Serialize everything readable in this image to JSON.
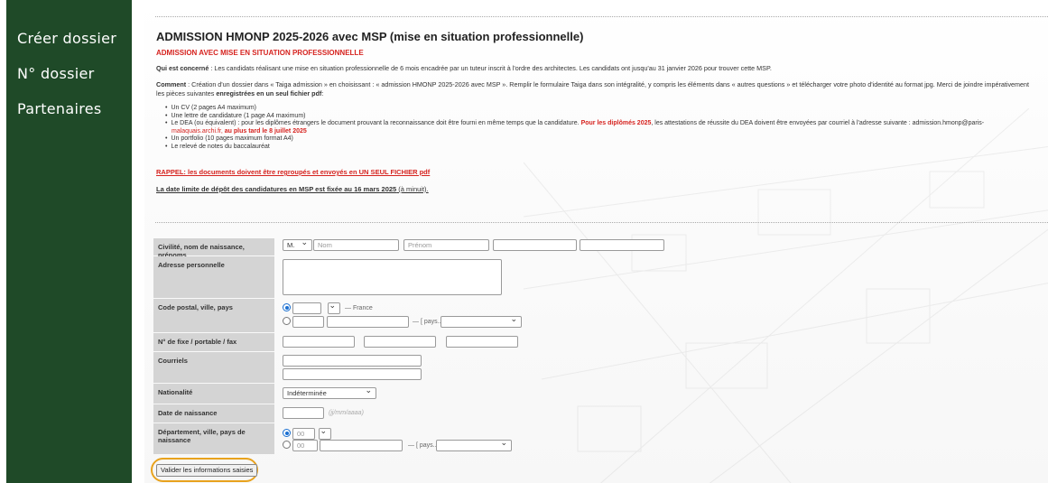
{
  "sidebar": {
    "items": [
      {
        "label": "Créer dossier"
      },
      {
        "label": "N° dossier"
      },
      {
        "label": "Partenaires"
      }
    ]
  },
  "page": {
    "title": "ADMISSION HMONP 2025-2026 avec MSP (mise en situation professionnelle)",
    "red_subtitle": "ADMISSION AVEC MISE EN SITUATION PROFESSIONNELLE",
    "who_label": "Qui est concerné",
    "who_text": " : Les candidats réalisant une mise en situation professionnelle de 6 mois encadrée par un tuteur inscrit à l'ordre des architectes. Les candidats ont jusqu'au 31 janvier 2026 pour trouver cette MSP.",
    "comment_label": "Comment",
    "comment_text": " : Création d'un dossier dans « Taiga admission » en choisissant : « admission HMONP 2025-2026 avec MSP ». Remplir le formulaire Taiga dans son intégralité, y compris les éléments dans « autres questions » et télécharger votre photo d'identité au format jpg. Merci de joindre impérativement",
    "comment_line2_a": "les pièces suivantes ",
    "comment_line2_b": "enregistrées en un seul fichier pdf",
    "comment_line2_c": ":",
    "docs": [
      "Un CV (2 pages A4 maximum)",
      "Une lettre de candidature (1 page A4 maximum)"
    ],
    "dea_a": "Le DEA (ou équivalent) : pour les diplômes étrangers le document prouvant la reconnaissance doit être fourni en même temps que la candidature. ",
    "dea_b": "Pour les diplômés 2025",
    "dea_c": ", les attestations de réussite du DEA doivent être envoyées par courriel à l'adresse suivante : admission.hmonp@paris-",
    "dea_d": "malaquais.archi.fr, ",
    "dea_e": "au plus tard le 8 juillet 2025",
    "docs_after": [
      "Un portfolio (10 pages maximum format A4)",
      "Le relevé de notes du baccalauréat"
    ],
    "rappel": "RAPPEL: les documents doivent être regroupés et envoyés en UN SEUL FICHIER pdf",
    "deadline_a": "La date limite de dépôt des candidatures en MSP est fixée au ",
    "deadline_b": "16 mars 2025",
    "deadline_c": " (à minuit)."
  },
  "form": {
    "labels": {
      "civility": "Civilité, nom de naissance, prénoms",
      "address": "Adresse personnelle",
      "postal": "Code postal, ville, pays",
      "phone": "N° de fixe / portable / fax",
      "emails": "Courriels",
      "nationality": "Nationalité",
      "birthdate": "Date de naissance",
      "birthplace": "Département, ville, pays de naissance"
    },
    "civility_value": "M.",
    "nom_placeholder": "Nom",
    "prenom_placeholder": "Prénom",
    "france_label": "— France",
    "pays_placeholder": "— [ pays... ]",
    "nationality_value": "Indéterminée",
    "date_hint": "(jj/mm/aaaa)",
    "dept_value": "00",
    "dept_value2": "00",
    "pays_placeholder2": "— [ pays... ]",
    "submit_label": "Valider les informations saisies"
  },
  "colors": {
    "sidebar_bg": "#1f4a28",
    "label_bg": "#d4d4d4",
    "accent_red": "#d6231f",
    "highlight": "#e8a21d"
  }
}
